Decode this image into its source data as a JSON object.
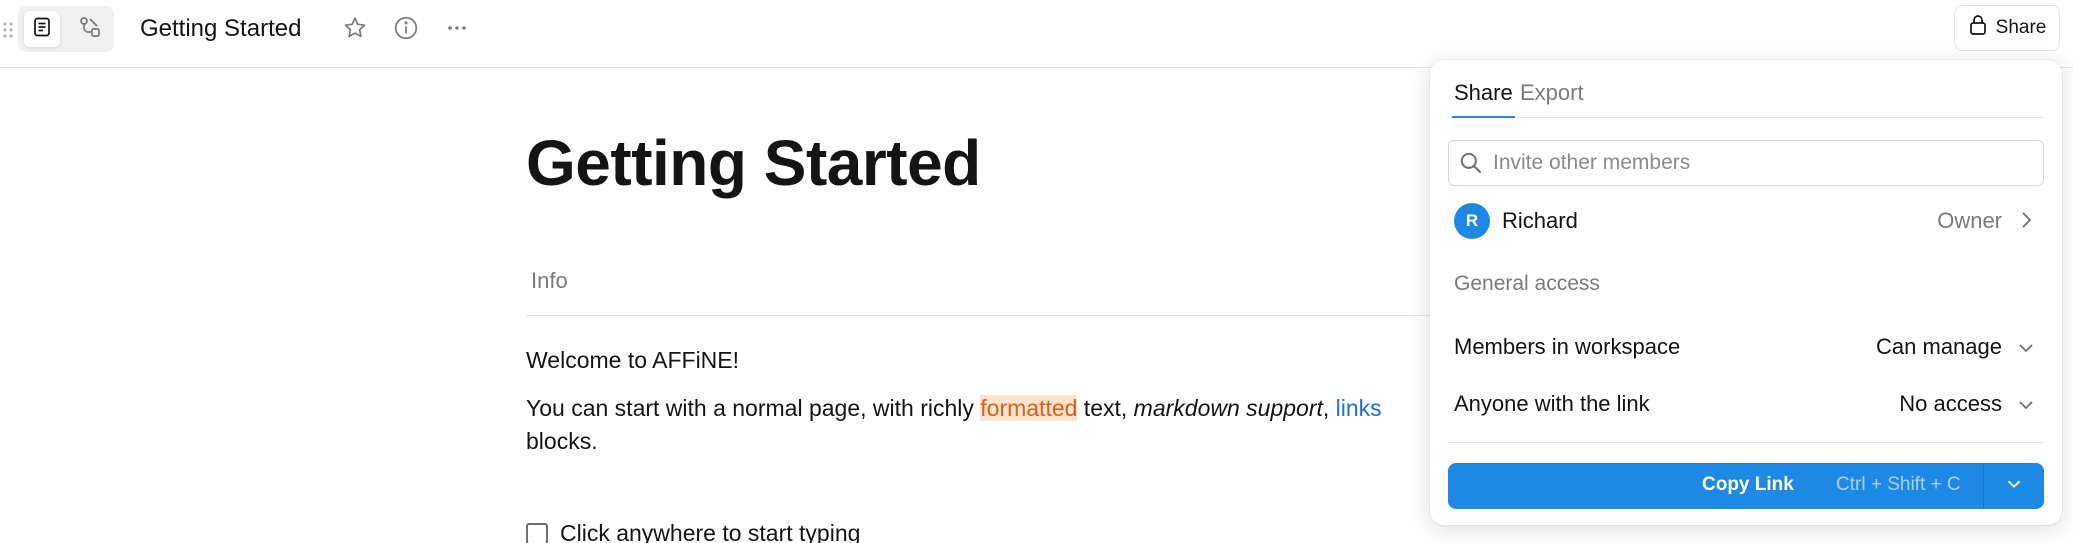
{
  "topbar": {
    "doc_title": "Getting Started",
    "share_label": "Share",
    "modes": [
      "page-mode",
      "edgeless-mode"
    ],
    "icons": [
      "drag-handle-icon",
      "page-icon",
      "edgeless-icon",
      "star-icon",
      "info-icon",
      "more-icon",
      "lock-icon"
    ]
  },
  "editor": {
    "heading": "Getting Started",
    "info_label": "Info",
    "welcome": "Welcome to AFFiNE!",
    "para_line1": {
      "part1": "You can start with a normal page, with richly ",
      "highlight": "formatted",
      "part2": " text, ",
      "italic": "markdown support",
      "part3": ", ",
      "link": "links"
    },
    "para_line2": "blocks.",
    "todo_text": "Click anywhere to start typing"
  },
  "share_popover": {
    "tabs": [
      "Share",
      "Export"
    ],
    "active_tab": "Share",
    "invite_placeholder": "Invite other members",
    "member": {
      "initial": "R",
      "name": "Richard",
      "role": "Owner"
    },
    "general_access_label": "General access",
    "access_rows": [
      {
        "label": "Members in workspace",
        "value": "Can manage"
      },
      {
        "label": "Anyone with the link",
        "value": "No access"
      }
    ],
    "copy_link_label": "Copy Link",
    "copy_link_shortcut": "Ctrl + Shift + C"
  },
  "colors": {
    "accent": "#1e88e5",
    "highlight_bg": "#fce4cf",
    "highlight_text": "#d9601a",
    "link": "#1e6fd9",
    "muted_text": "#7a7a7a"
  }
}
